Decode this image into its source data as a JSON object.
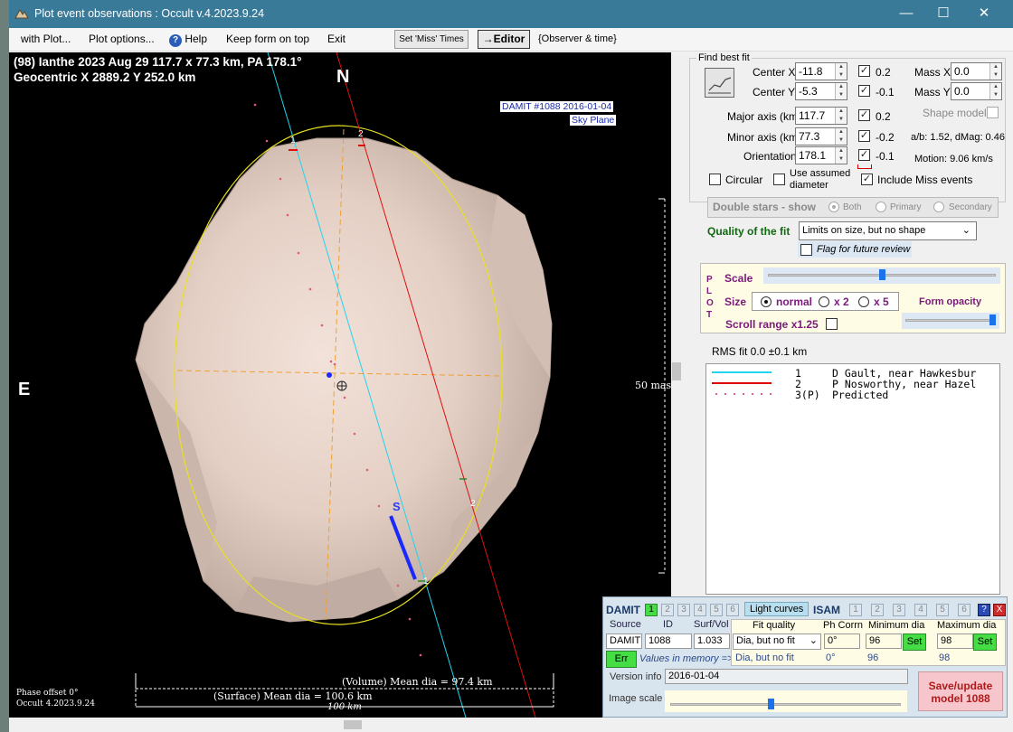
{
  "window": {
    "title": "Plot event observations : Occult v.4.2023.9.24",
    "minimize": "—",
    "maximize": "☐",
    "close": "✕"
  },
  "menu": {
    "with_plot": "with Plot...",
    "plot_options": "Plot options...",
    "help": "Help",
    "keep_on_top": "Keep form on top",
    "exit": "Exit",
    "set_miss_times": "Set 'Miss' Times",
    "editor": "→Editor",
    "observer_time": "{Observer & time}"
  },
  "plot": {
    "header_line1": "(98) Ianthe  2023 Aug 29   117.7 x 77.3 km,  PA 178.1°",
    "header_line2": "Geocentric  X  2889.2  Y 252.0 km",
    "north": "N",
    "east": "E",
    "south_marker": "S",
    "damit_label": "DAMIT #1088 2016-01-04",
    "sky_plane": "Sky Plane",
    "scale_label": "50 mas",
    "chord1_top": "1",
    "chord2_top": "2",
    "chord1_bottom": "1",
    "chord2_bottom": "2",
    "phase_offset": "Phase offset 0°",
    "version": "Occult 4.2023.9.24",
    "volume_dia": "(Volume) Mean dia = 97.4 km",
    "surface_dia": "(Surface) Mean dia = 100.6 km",
    "scale_bar": "100 km"
  },
  "fit": {
    "group_title": "Find best fit",
    "center_x": {
      "label": "Center X",
      "value": "-11.8",
      "check_value": "0.2"
    },
    "center_y": {
      "label": "Center Y",
      "value": "-5.3",
      "check_value": "-0.1"
    },
    "major_axis": {
      "label": "Major axis (km)",
      "value": "117.7",
      "check_value": "0.2"
    },
    "minor_axis": {
      "label": "Minor axis (km)",
      "value": "77.3",
      "check_value": "-0.2"
    },
    "orientation": {
      "label": "Orientation",
      "value": "178.1",
      "check_value": "-0.1"
    },
    "mass_x": {
      "label": "Mass X",
      "value": "0.0"
    },
    "mass_y": {
      "label": "Mass Y",
      "value": "0.0"
    },
    "shape_model": "Shape model",
    "ab_dmag": "a/b: 1.52, dMag: 0.46",
    "motion": "Motion: 9.06 km/s",
    "circular": "Circular",
    "use_assumed_1": "Use assumed",
    "use_assumed_2": "diameter",
    "include_miss": "Include Miss events",
    "double_stars": "Double stars - show",
    "both": "Both",
    "primary": "Primary",
    "secondary": "Secondary",
    "quality_label": "Quality of the fit",
    "quality_value": "Limits on size, but no shape",
    "flag_review": "Flag for future review"
  },
  "plotctl": {
    "p": "P",
    "l": "L",
    "o": "O",
    "t": "T",
    "scale": "Scale",
    "size": "Size",
    "normal": "normal",
    "x2": "x 2",
    "x5": "x 5",
    "form_opacity": "Form opacity",
    "scroll_range": "Scroll range x1.25",
    "scale_fraction": 0.5,
    "opacity_fraction": 0.98
  },
  "rms": "RMS fit 0.0 ±0.1 km",
  "legend": [
    {
      "num": "1",
      "text": "D Gault, near Hawkesbur",
      "color": "#22d3ee",
      "style": "solid"
    },
    {
      "num": "2",
      "text": "P Nosworthy, near Hazel",
      "color": "#dd0000",
      "style": "solid"
    },
    {
      "num": "3(P)",
      "text": "Predicted",
      "color": "#e05a7a",
      "style": "dots"
    }
  ],
  "damit": {
    "title": "DAMIT",
    "tab1": "1",
    "tab2": "2",
    "tab3": "3",
    "tab4": "4",
    "tab5": "5",
    "tab6": "6",
    "light_curves": "Light curves",
    "isam": "ISAM",
    "help": "?",
    "close": "X",
    "source_hdr": "Source",
    "id_hdr": "ID",
    "surf_hdr": "Surf/Vol",
    "fit_quality_hdr": "Fit quality",
    "ph_corrn_hdr": "Ph Corrn",
    "min_dia_hdr": "Minimum dia",
    "max_dia_hdr": "Maximum dia",
    "source": "DAMIT",
    "id": "1088",
    "surf_vol": "1.033",
    "fit_quality": "Dia, but no fit",
    "ph_corrn": "0°",
    "min_dia": "96",
    "max_dia": "98",
    "set": "Set",
    "err": "Err",
    "values_in_memory": "Values in memory =>",
    "mem_fit": "Dia, but no fit",
    "mem_ph": "0°",
    "mem_min": "96",
    "mem_max": "98",
    "version_label": "Version info",
    "version_value": "2016-01-04",
    "image_scale": "Image scale",
    "image_scale_fraction": 0.43,
    "save_line1": "Save/update",
    "save_line2": "model 1088"
  }
}
